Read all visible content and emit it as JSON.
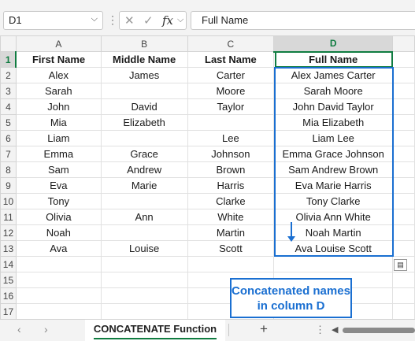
{
  "formula_bar": {
    "name_box": "D1",
    "cancel_icon": "✕",
    "enter_icon": "✓",
    "fx_label": "fx",
    "formula": "Full Name"
  },
  "columns": [
    "A",
    "B",
    "C",
    "D"
  ],
  "rows": [
    "1",
    "2",
    "3",
    "4",
    "5",
    "6",
    "7",
    "8",
    "9",
    "10",
    "11",
    "12",
    "13",
    "14",
    "15",
    "16",
    "17"
  ],
  "table": {
    "headers": [
      "First Name",
      "Middle Name",
      "Last Name",
      "Full Name"
    ],
    "data": [
      [
        "Alex",
        "James",
        "Carter",
        "Alex James Carter"
      ],
      [
        "Sarah",
        "",
        "Moore",
        "Sarah  Moore"
      ],
      [
        "John",
        "David",
        "Taylor",
        "John David Taylor"
      ],
      [
        "Mia",
        "Elizabeth",
        "",
        "Mia Elizabeth"
      ],
      [
        "Liam",
        "",
        "Lee",
        "Liam  Lee"
      ],
      [
        "Emma",
        "Grace",
        "Johnson",
        "Emma Grace Johnson"
      ],
      [
        "Sam",
        "Andrew",
        "Brown",
        "Sam Andrew Brown"
      ],
      [
        "Eva",
        "Marie",
        "Harris",
        "Eva Marie Harris"
      ],
      [
        "Tony",
        "",
        "Clarke",
        "Tony  Clarke"
      ],
      [
        "Olivia",
        "Ann",
        "White",
        "Olivia Ann White"
      ],
      [
        "Noah",
        "",
        "Martin",
        "Noah  Martin"
      ],
      [
        "Ava",
        "Louise",
        "Scott",
        "Ava Louise Scott"
      ]
    ]
  },
  "callout": {
    "line1": "Concatenated names",
    "line2": "in column D"
  },
  "sheet_tabs": {
    "active": "CONCATENATE Function",
    "prev_icon": "‹",
    "next_icon": "›",
    "add_icon": "+"
  },
  "colors": {
    "accent_green": "#107c41",
    "highlight_blue": "#1a6fd1"
  }
}
